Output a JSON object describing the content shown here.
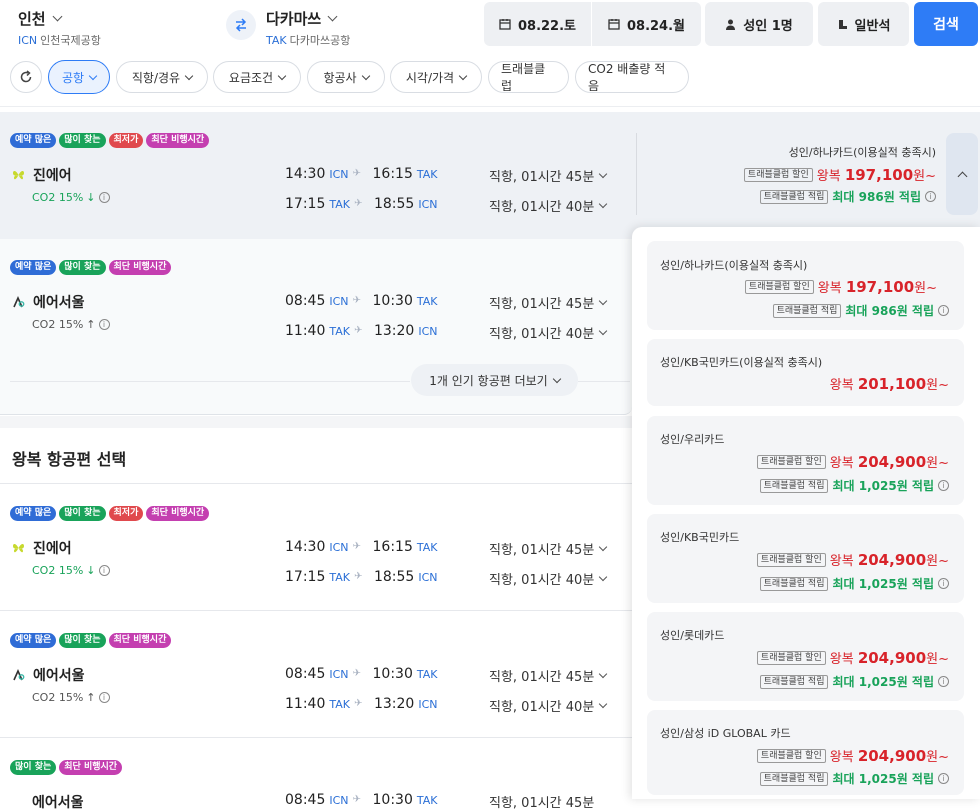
{
  "header": {
    "origin": {
      "city": "인천",
      "code": "ICN",
      "airport": "인천국제공항"
    },
    "destination": {
      "city": "다카마쓰",
      "code": "TAK",
      "airport": "다카마쓰공항"
    },
    "date_out": "08.22.토",
    "date_in": "08.24.월",
    "passengers": "성인 1명",
    "cabin": "일반석",
    "search_label": "검색"
  },
  "filters": [
    "공항",
    "직항/경유",
    "요금조건",
    "항공사",
    "시각/가격",
    "트래블클럽",
    "CO2 배출량 적음"
  ],
  "badges": {
    "many_booked": "예약 많은",
    "many_viewed": "많이 찾는",
    "lowest": "최저가",
    "shortest": "최단 비행시간"
  },
  "outbound": [
    {
      "airline": "진에어",
      "co2": "CO2 15%",
      "legs": [
        {
          "dep": "14:30",
          "dep_ap": "ICN",
          "arr": "16:15",
          "arr_ap": "TAK",
          "dur": "직항, 01시간 45분"
        },
        {
          "dep": "17:15",
          "dep_ap": "TAK",
          "arr": "18:55",
          "arr_ap": "ICN",
          "dur": "직항, 01시간 40분"
        }
      ]
    },
    {
      "airline": "에어서울",
      "co2": "CO2 15%",
      "legs": [
        {
          "dep": "08:45",
          "dep_ap": "ICN",
          "arr": "10:30",
          "arr_ap": "TAK",
          "dur": "직항, 01시간 45분"
        },
        {
          "dep": "11:40",
          "dep_ap": "TAK",
          "arr": "13:20",
          "arr_ap": "ICN",
          "dur": "직항, 01시간 40분"
        }
      ]
    }
  ],
  "more_flights_label": "1개 인기 항공편 더보기",
  "section_title": "왕복 항공편 선택",
  "return_list": [
    {
      "airline": "진에어",
      "co2": "CO2 15%",
      "legs": [
        {
          "dep": "14:30",
          "dep_ap": "ICN",
          "arr": "16:15",
          "arr_ap": "TAK",
          "dur": "직항, 01시간 45분"
        },
        {
          "dep": "17:15",
          "dep_ap": "TAK",
          "arr": "18:55",
          "arr_ap": "ICN",
          "dur": "직항, 01시간 40분"
        }
      ]
    },
    {
      "airline": "에어서울",
      "co2": "CO2 15%",
      "legs": [
        {
          "dep": "08:45",
          "dep_ap": "ICN",
          "arr": "10:30",
          "arr_ap": "TAK",
          "dur": "직항, 01시간 45분"
        },
        {
          "dep": "11:40",
          "dep_ap": "TAK",
          "arr": "13:20",
          "arr_ap": "ICN",
          "dur": "직항, 01시간 40분"
        }
      ]
    }
  ],
  "partial_row": {
    "airline": "에어서울",
    "dep": "08:45",
    "dep_ap": "ICN",
    "arr": "10:30",
    "arr_ap": "TAK",
    "dur": "직항, 01시간 45분"
  },
  "top_price": {
    "label": "성인/하나카드(이용실적 충족시)",
    "discount_tag": "트래블클럽 할인",
    "points_tag": "트래블클럽 적립",
    "round": "왕복",
    "price": "197,100",
    "unit": "원~",
    "points": "최대 986원 적립"
  },
  "price_cards": [
    {
      "label": "성인/하나카드(이용실적 충족시)",
      "discount_tag": "트래블클럽 할인",
      "round": "왕복",
      "price": "197,100",
      "unit": "원~",
      "points_tag": "트래블클럽 적립",
      "points": "최대 986원 적립"
    },
    {
      "label": "성인/KB국민카드(이용실적 충족시)",
      "round": "왕복",
      "price": "201,100",
      "unit": "원~"
    },
    {
      "label": "성인/우리카드",
      "discount_tag": "트래블클럽 할인",
      "round": "왕복",
      "price": "204,900",
      "unit": "원~",
      "points_tag": "트래블클럽 적립",
      "points": "최대 1,025원 적립"
    },
    {
      "label": "성인/KB국민카드",
      "discount_tag": "트래블클럽 할인",
      "round": "왕복",
      "price": "204,900",
      "unit": "원~",
      "points_tag": "트래블클럽 적립",
      "points": "최대 1,025원 적립"
    },
    {
      "label": "성인/롯데카드",
      "discount_tag": "트래블클럽 할인",
      "round": "왕복",
      "price": "204,900",
      "unit": "원~",
      "points_tag": "트래블클럽 적립",
      "points": "최대 1,025원 적립"
    },
    {
      "label": "성인/삼성 iD GLOBAL 카드",
      "discount_tag": "트래블클럽 할인",
      "round": "왕복",
      "price": "204,900",
      "unit": "원~",
      "points_tag": "트래블클럽 적립",
      "points": "최대 1,025원 적립"
    }
  ]
}
